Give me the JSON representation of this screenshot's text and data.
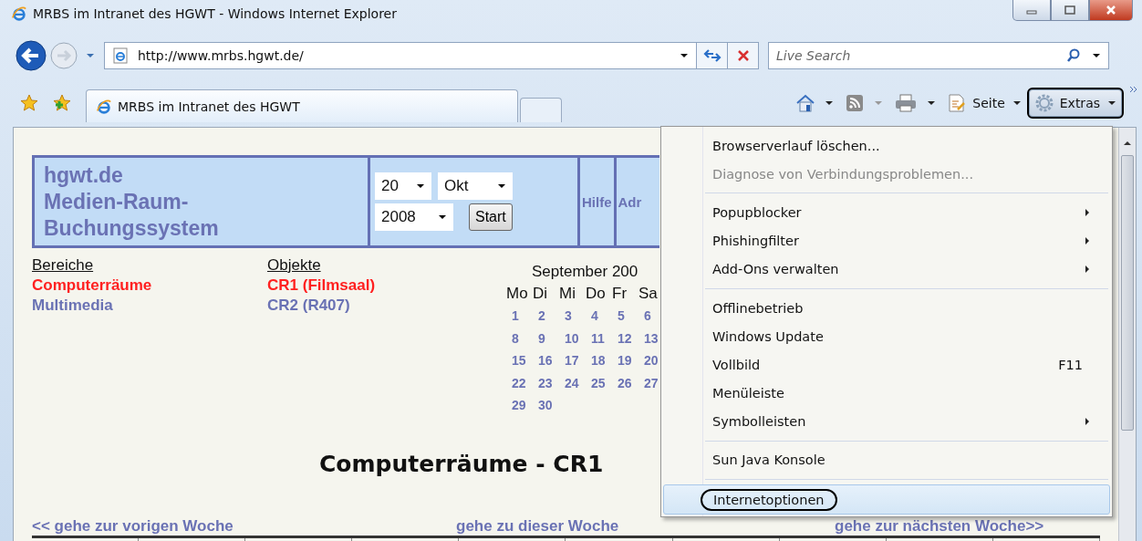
{
  "window": {
    "title": "MRBS im Intranet des HGWT - Windows Internet Explorer"
  },
  "address_bar": {
    "url": "http://www.mrbs.hgwt.de/"
  },
  "search": {
    "placeholder": "Live Search"
  },
  "tabs": [
    {
      "label": "MRBS im Intranet des HGWT",
      "selected": true
    }
  ],
  "command_bar": {
    "page_label": "Seite",
    "tools": {
      "label": "Extras",
      "expanded": true
    }
  },
  "page": {
    "header": {
      "title_lines": [
        "hgwt.de",
        "Medien-Raum-",
        "Buchungssystem"
      ],
      "day": "20",
      "month": "Okt",
      "year": "2008",
      "start_button": "Start",
      "links": [
        "Hilfe",
        "Adr"
      ]
    },
    "areas": {
      "heading": "Bereiche",
      "items": [
        {
          "label": "Computerräume",
          "selected": true
        },
        {
          "label": "Multimedia",
          "selected": false
        }
      ]
    },
    "rooms": {
      "heading": "Objekte",
      "items": [
        {
          "label": "CR1 (Filmsaal)",
          "selected": true
        },
        {
          "label": "CR2 (R407)",
          "selected": false
        }
      ]
    },
    "calendar": {
      "month": "September 200",
      "weekdays": [
        "Mo",
        "Di",
        "Mi",
        "Do",
        "Fr",
        "Sa"
      ],
      "weeks": [
        [
          "1",
          "2",
          "3",
          "4",
          "5",
          "6"
        ],
        [
          "8",
          "9",
          "10",
          "11",
          "12",
          "13"
        ],
        [
          "15",
          "16",
          "17",
          "18",
          "19",
          "20"
        ],
        [
          "22",
          "23",
          "24",
          "25",
          "26",
          "27"
        ],
        [
          "29",
          "30"
        ]
      ]
    },
    "heading": "Computerräume - CR1",
    "week_nav": [
      "<< gehe zur vorigen Woche",
      "gehe zu dieser Woche",
      "gehe zur nächsten Woche>>"
    ]
  },
  "menu": {
    "items": [
      {
        "kind": "item",
        "label": "Browserverlauf löschen...",
        "disabled": false,
        "submenu": false,
        "selected": false
      },
      {
        "kind": "item",
        "label": "Diagnose von Verbindungsproblemen...",
        "disabled": true,
        "submenu": false,
        "selected": false
      },
      {
        "kind": "separator"
      },
      {
        "kind": "item",
        "label": "Popupblocker",
        "disabled": false,
        "submenu": true,
        "selected": false
      },
      {
        "kind": "item",
        "label": "Phishingfilter",
        "disabled": false,
        "submenu": true,
        "selected": false
      },
      {
        "kind": "item",
        "label": "Add-Ons verwalten",
        "disabled": false,
        "submenu": true,
        "selected": false
      },
      {
        "kind": "separator"
      },
      {
        "kind": "item",
        "label": "Offlinebetrieb",
        "disabled": false,
        "submenu": false,
        "selected": false
      },
      {
        "kind": "item",
        "label": "Windows Update",
        "disabled": false,
        "submenu": false,
        "selected": false
      },
      {
        "kind": "item",
        "label": "Vollbild",
        "shortcut": "F11",
        "disabled": false,
        "submenu": false,
        "selected": false
      },
      {
        "kind": "item",
        "label": "Menüleiste",
        "disabled": false,
        "submenu": false,
        "selected": false
      },
      {
        "kind": "item",
        "label": "Symbolleisten",
        "disabled": false,
        "submenu": true,
        "selected": false
      },
      {
        "kind": "separator"
      },
      {
        "kind": "item",
        "label": "Sun Java Konsole",
        "disabled": false,
        "submenu": false,
        "selected": false
      },
      {
        "kind": "separator"
      },
      {
        "kind": "item",
        "label": "Internetoptionen",
        "disabled": false,
        "submenu": false,
        "selected": true
      }
    ]
  }
}
